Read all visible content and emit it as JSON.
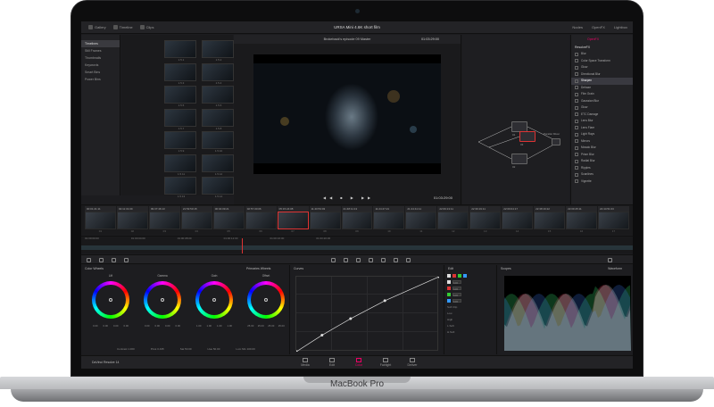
{
  "device": {
    "brand": "MacBook Pro"
  },
  "app": {
    "name": "DaVinci Resolve 14",
    "project_title": "URSA Mini 4.6K short film"
  },
  "topbar": {
    "gallery": "Gallery",
    "timeline": "Timeline",
    "clips": "Clips",
    "nodes": "Nodes",
    "openfx": "OpenFX",
    "lightbox": "Lightbox"
  },
  "media_sidebar": {
    "items": [
      "Timelines",
      "Still Frames",
      "Thumbnails",
      "Keywords",
      "Smart Bins",
      "Power Bins"
    ]
  },
  "media_thumbs": [
    "1.5.1",
    "1.5.2",
    "1.5.3",
    "1.5.4",
    "1.5.5",
    "1.5.6",
    "1.5.7",
    "1.5.8",
    "1.5.9",
    "1.5.10",
    "1.5.11",
    "1.5.12",
    "1.5.13",
    "1.5.14"
  ],
  "viewer": {
    "title": "Brokeback's episode 09 Master",
    "timecode": "01:03:29:00"
  },
  "nodes": {
    "items": [
      {
        "label": "01"
      },
      {
        "label": "02"
      },
      {
        "label": "03"
      },
      {
        "label": "Parallel Mixer"
      }
    ]
  },
  "openfx": {
    "category": "ResolveFX",
    "items": [
      "Blur",
      "Color Space Transform",
      "Glow",
      "Directional Blur",
      "Sharpen",
      "Dehaze",
      "Film Grain",
      "Gaussian Blur",
      "Glow",
      "ETC Damage",
      "Lens Blur",
      "Lens Flare",
      "Light Rays",
      "Mirrors",
      "Mosaic Blur",
      "Prism Blur",
      "Radial Blur",
      "Ripples",
      "Scanlines",
      "Vignette"
    ],
    "selected": 4
  },
  "clips": [
    {
      "tc": "00:01:21:11",
      "n": "01"
    },
    {
      "tc": "02:11:31:09",
      "n": "02"
    },
    {
      "tc": "09:37:46:13",
      "n": "03"
    },
    {
      "tc": "21:53:50:15",
      "n": "04"
    },
    {
      "tc": "00:04:09:21",
      "n": "05"
    },
    {
      "tc": "02:57:30:06",
      "n": "06"
    },
    {
      "tc": "05:15:24:08",
      "n": "07"
    },
    {
      "tc": "11:40:53:03",
      "n": "08"
    },
    {
      "tc": "21:48:11:13",
      "n": "09"
    },
    {
      "tc": "11:24:47:21",
      "n": "10"
    },
    {
      "tc": "21:44:41:11",
      "n": "11"
    },
    {
      "tc": "22:09:13:11",
      "n": "12"
    },
    {
      "tc": "22:39:19:11",
      "n": "13"
    },
    {
      "tc": "22:09:04:17",
      "n": "14"
    },
    {
      "tc": "22:38:19:22",
      "n": "15"
    },
    {
      "tc": "22:09:45:11",
      "n": "16"
    },
    {
      "tc": "22:44:51:03",
      "n": "17"
    }
  ],
  "timeline": {
    "ruler": [
      "01:00:00:00",
      "01:00:04:00",
      "01:00:08:00",
      "01:00:12:00",
      "01:00:16:00",
      "01:00:20:00"
    ]
  },
  "color_wheels": {
    "title": "Color Wheels",
    "mode": "Primaries Wheels",
    "wheels": [
      {
        "name": "Lift",
        "vals": [
          "0.00",
          "0.00",
          "0.00",
          "0.00"
        ]
      },
      {
        "name": "Gamma",
        "vals": [
          "0.00",
          "0.00",
          "0.00",
          "0.00"
        ]
      },
      {
        "name": "Gain",
        "vals": [
          "1.00",
          "1.00",
          "1.00",
          "1.00"
        ]
      },
      {
        "name": "Offset",
        "vals": [
          "25.00",
          "25.00",
          "25.00",
          "25.00"
        ]
      }
    ],
    "footer": [
      "Contrast 1.000",
      "Pivot 0.435",
      "Sat 50.00",
      "Hue 50.00",
      "Lum Mix 100.00"
    ]
  },
  "curves": {
    "title": "Curves",
    "points": [
      [
        0,
        0
      ],
      [
        0.18,
        0.22
      ],
      [
        0.38,
        0.44
      ],
      [
        0.62,
        0.68
      ],
      [
        1,
        1
      ]
    ]
  },
  "edit": {
    "title": "Edit",
    "rows": [
      "100",
      "100",
      "100",
      "100"
    ],
    "soft_clip": "Soft Clip",
    "soft_rows": [
      "Low",
      "High",
      "L.Soft",
      "H.Soft"
    ]
  },
  "scopes": {
    "title": "Scopes",
    "mode": "Waveform"
  },
  "pages": {
    "items": [
      "Media",
      "Edit",
      "Color",
      "Fairlight",
      "Deliver"
    ],
    "selected": 2
  }
}
